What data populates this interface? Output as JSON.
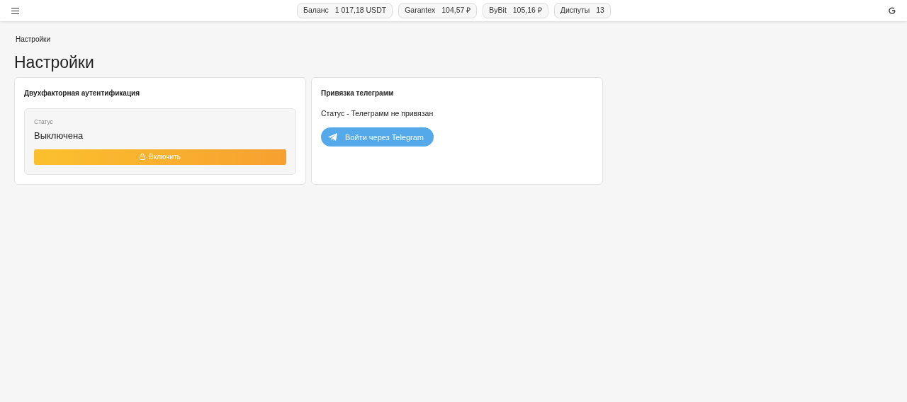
{
  "header": {
    "stats": [
      {
        "label": "Баланс",
        "value": "1 017,18 USDT"
      },
      {
        "label": "Garantex",
        "value": "104,57 ₽"
      },
      {
        "label": "ByBit",
        "value": "105,16 ₽"
      },
      {
        "label": "Диспуты",
        "value": "13"
      }
    ]
  },
  "breadcrumb": "Настройки",
  "page_title": "Настройки",
  "cards": [
    {
      "kind": "twofa",
      "title": "Двухфакторная аутентификация",
      "status_label": "Статус",
      "status_value": "Выключена",
      "button": "Включить"
    },
    {
      "kind": "telegram",
      "title": "Привязка телеграмм",
      "status_text": "Статус - Телеграмм не привязан",
      "button": "Войти через Telegram"
    }
  ]
}
